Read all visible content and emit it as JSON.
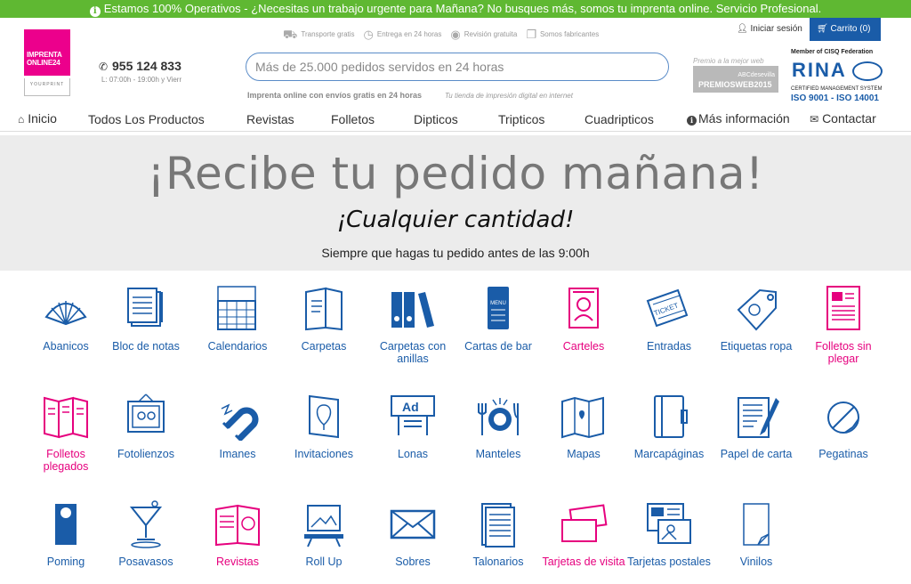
{
  "topbar": {
    "message": "Estamos 100% Operativos - ¿Necesitas un trabajo urgente para Mañana? No busques más, somos tu imprenta online. Servicio Profesional."
  },
  "header": {
    "logo_line1": "IMPRENTA",
    "logo_line2": "ONLINE24",
    "logo_sub": "YOURPRINT",
    "phone": "955 124 833",
    "hours": "L: 07:00h - 19:00h y Vierr",
    "features": [
      "Transporte gratis",
      "Entrega en 24 horas",
      "Revisión gratuita",
      "Somos fabricantes"
    ],
    "search_placeholder": "Más de 25.000 pedidos servidos en 24 horas",
    "tagline1": "Imprenta online con envíos gratis en 24 horas",
    "tagline2": "Tu tienda de impresión digital en internet",
    "login": "Iniciar sesión",
    "cart": "Carrito (0)",
    "premio_caption": "Premio a la mejor web",
    "premio_small": "ABCdesevilla",
    "premio_main": "PREMIOSWEB2015",
    "rina_caption": "Member of CISQ Federation",
    "rina_logo": "RINA",
    "rina_cms": "CERTIFIED MANAGEMENT SYSTEM",
    "rina_iso": "ISO 9001 - ISO 14001"
  },
  "nav": {
    "inicio": "Inicio",
    "todos": "Todos Los Productos",
    "revistas": "Revistas",
    "folletos": "Folletos",
    "dipticos": "Dipticos",
    "tripticos": "Tripticos",
    "cuadripticos": "Cuadripticos",
    "info": "Más información",
    "contactar": "Contactar"
  },
  "hero": {
    "title": "¡Recibe tu pedido mañana!",
    "subtitle": "¡Cualquier cantidad!",
    "note": "Siempre que hagas tu pedido antes de las 9:00h"
  },
  "colors": {
    "green": "#5fb832",
    "blue": "#1a5ca8",
    "pink": "#e6007e"
  },
  "products": [
    {
      "label": "Abanicos",
      "icon": "fan-icon",
      "color": "blue"
    },
    {
      "label": "Bloc de notas",
      "icon": "notepad-icon",
      "color": "blue"
    },
    {
      "label": "Calendarios",
      "icon": "calendar-icon",
      "color": "blue"
    },
    {
      "label": "Carpetas",
      "icon": "folder-icon",
      "color": "blue"
    },
    {
      "label": "Carpetas con anillas",
      "icon": "binder-icon",
      "color": "blue"
    },
    {
      "label": "Cartas de bar",
      "icon": "menu-icon",
      "color": "blue"
    },
    {
      "label": "Carteles",
      "icon": "poster-icon",
      "color": "pink"
    },
    {
      "label": "Entradas",
      "icon": "ticket-icon",
      "color": "blue"
    },
    {
      "label": "Etiquetas ropa",
      "icon": "clothing-tag-icon",
      "color": "blue"
    },
    {
      "label": "Folletos sin plegar",
      "icon": "flyer-icon",
      "color": "pink"
    },
    {
      "label": "Folletos plegados",
      "icon": "folded-flyer-icon",
      "color": "pink"
    },
    {
      "label": "Fotolienzos",
      "icon": "photo-canvas-icon",
      "color": "blue"
    },
    {
      "label": "Imanes",
      "icon": "magnet-icon",
      "color": "blue"
    },
    {
      "label": "Invitaciones",
      "icon": "invitation-icon",
      "color": "blue"
    },
    {
      "label": "Lonas",
      "icon": "banner-icon",
      "color": "blue"
    },
    {
      "label": "Manteles",
      "icon": "tablecloth-icon",
      "color": "blue"
    },
    {
      "label": "Mapas",
      "icon": "map-icon",
      "color": "blue"
    },
    {
      "label": "Marcapáginas",
      "icon": "bookmark-icon",
      "color": "blue"
    },
    {
      "label": "Papel de carta",
      "icon": "letter-paper-icon",
      "color": "blue"
    },
    {
      "label": "Pegatinas",
      "icon": "sticker-icon",
      "color": "blue"
    },
    {
      "label": "Poming",
      "icon": "door-hanger-icon",
      "color": "blue"
    },
    {
      "label": "Posavasos",
      "icon": "coaster-icon",
      "color": "blue"
    },
    {
      "label": "Revistas",
      "icon": "magazine-icon",
      "color": "pink"
    },
    {
      "label": "Roll Up",
      "icon": "rollup-icon",
      "color": "blue"
    },
    {
      "label": "Sobres",
      "icon": "envelope-icon",
      "color": "blue"
    },
    {
      "label": "Talonarios",
      "icon": "receipt-book-icon",
      "color": "blue"
    },
    {
      "label": "Tarjetas de visita",
      "icon": "business-card-icon",
      "color": "pink"
    },
    {
      "label": "Tarjetas postales",
      "icon": "postcard-icon",
      "color": "blue"
    },
    {
      "label": "Vinilos",
      "icon": "vinyl-icon",
      "color": "blue"
    }
  ]
}
